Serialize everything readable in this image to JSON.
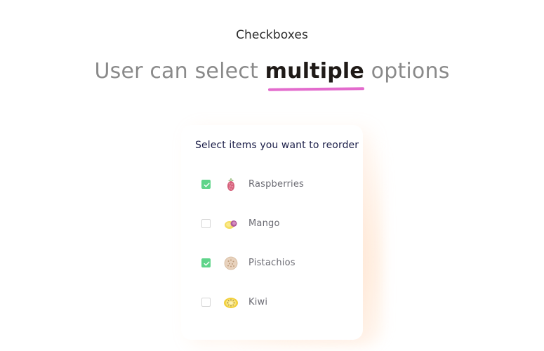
{
  "header": {
    "small_title": "Checkboxes",
    "headline_prefix": "User can select ",
    "headline_emphasis": "multiple",
    "headline_suffix": " options"
  },
  "card": {
    "title": "Select items you want to reorder",
    "items": [
      {
        "label": "Raspberries",
        "checked": true,
        "icon": "raspberry-icon"
      },
      {
        "label": "Mango",
        "checked": false,
        "icon": "mango-icon"
      },
      {
        "label": "Pistachios",
        "checked": true,
        "icon": "pistachio-icon"
      },
      {
        "label": "Kiwi",
        "checked": false,
        "icon": "kiwi-icon"
      }
    ]
  },
  "colors": {
    "accent_underline": "#e36bcd",
    "checkbox_checked": "#5fd48a",
    "card_title": "#1b1e48",
    "label": "#6b6b73"
  }
}
